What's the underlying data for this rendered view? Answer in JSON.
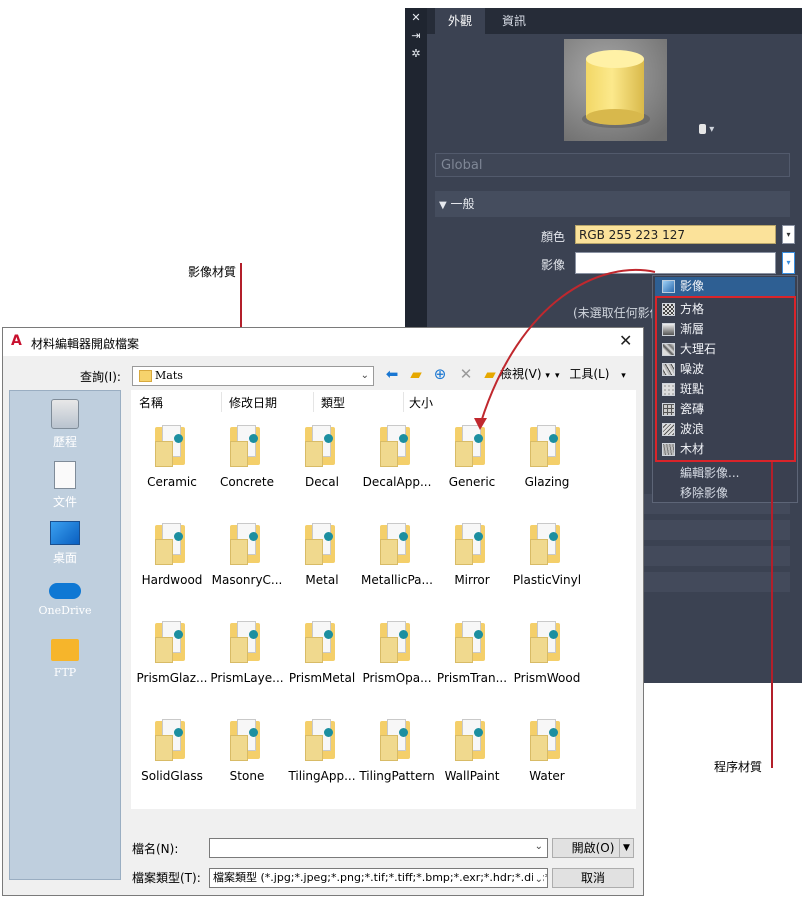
{
  "material_editor": {
    "sidebar_icons": [
      "close-icon",
      "pin-icon",
      "settings-icon"
    ],
    "tabs": [
      {
        "label": "外觀"
      },
      {
        "label": "資訊"
      }
    ],
    "preview_shape_icon": "cylinder-icon",
    "global_field": "Global",
    "section_title": "一般",
    "color_label": "顏色",
    "color_value": "RGB 255 223 127",
    "color_hex": "#FFDF7F",
    "image_label": "影像",
    "no_image_text": "(未選取任何影像)"
  },
  "procedural_menu": {
    "items": [
      {
        "label": "影像",
        "icon": "image-icon"
      },
      {
        "label": "方格",
        "icon": "checker-icon"
      },
      {
        "label": "漸層",
        "icon": "gradient-icon"
      },
      {
        "label": "大理石",
        "icon": "marble-icon"
      },
      {
        "label": "噪波",
        "icon": "noise-icon"
      },
      {
        "label": "斑點",
        "icon": "speckle-icon"
      },
      {
        "label": "瓷磚",
        "icon": "tiles-icon"
      },
      {
        "label": "波浪",
        "icon": "waves-icon"
      },
      {
        "label": "木材",
        "icon": "wood-icon"
      }
    ],
    "commands": [
      "編輯影像...",
      "移除影像"
    ]
  },
  "annotations": {
    "image_material": "影像材質",
    "procedural_material": "程序材質"
  },
  "file_dialog": {
    "title": "材料編輯器開啟檔案",
    "look_in_label": "查詢(I):",
    "look_in_value": "Mats",
    "toolbar": {
      "views_label": "檢視(V)",
      "tools_label": "工具(L)"
    },
    "places": [
      {
        "label": "歷程",
        "icon": "history-icon"
      },
      {
        "label": "文件",
        "icon": "documents-icon"
      },
      {
        "label": "桌面",
        "icon": "desktop-icon"
      },
      {
        "label": "OneDrive",
        "icon": "onedrive-icon"
      },
      {
        "label": "FTP",
        "icon": "ftp-folder-icon"
      }
    ],
    "columns": [
      "名稱",
      "修改日期",
      "類型",
      "大小"
    ],
    "files": [
      "Ceramic",
      "Concrete",
      "Decal",
      "DecalApp...",
      "Generic",
      "Glazing",
      "Hardwood",
      "MasonryC...",
      "Metal",
      "MetallicPa...",
      "Mirror",
      "PlasticVinyl",
      "PrismGlaz...",
      "PrismLaye...",
      "PrismMetal",
      "PrismOpa...",
      "PrismTran...",
      "PrismWood",
      "SolidGlass",
      "Stone",
      "TilingApp...",
      "TilingPattern",
      "WallPaint",
      "Water"
    ],
    "filename_label": "檔名(N):",
    "filename_value": "",
    "filetype_label": "檔案類型(T):",
    "filetype_value": "檔案類型 (*.jpg;*.jpeg;*.png;*.tif;*.tiff;*.bmp;*.exr;*.hdr;*.dib;*",
    "open_button": "開啟(O)",
    "cancel_button": "取消"
  }
}
